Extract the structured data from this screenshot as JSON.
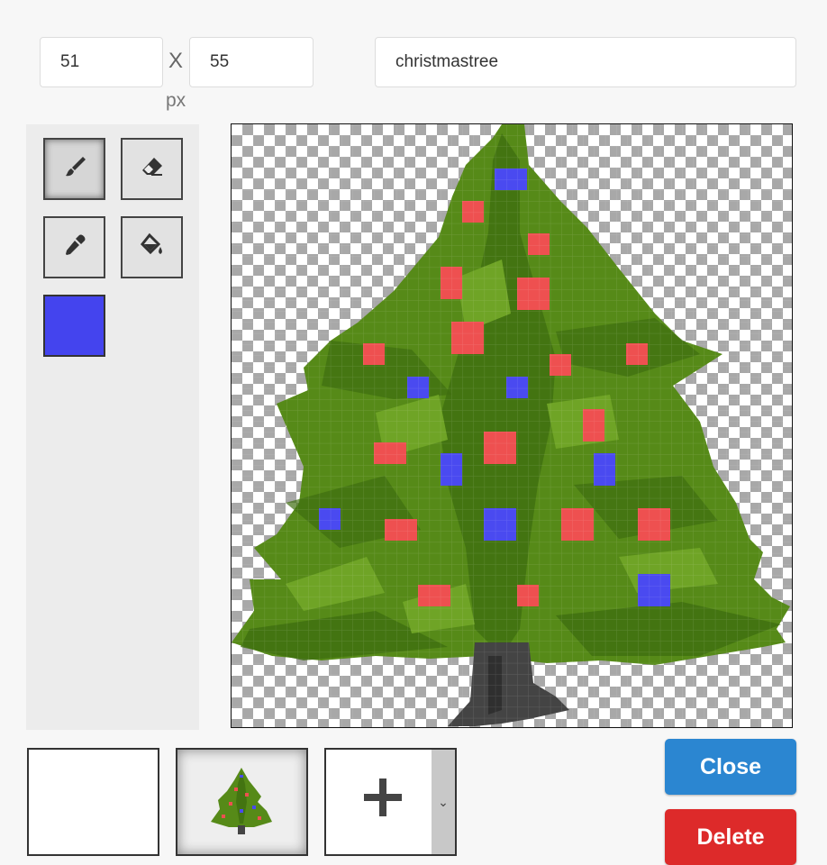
{
  "size": {
    "width_value": "51",
    "height_value": "55",
    "times_label": "X",
    "unit_label": "px"
  },
  "sprite": {
    "name_value": "christmastree"
  },
  "tools": [
    {
      "name": "brush",
      "icon": "paintbrush-icon",
      "active": true
    },
    {
      "name": "eraser",
      "icon": "eraser-icon",
      "active": false
    },
    {
      "name": "eyedropper",
      "icon": "eyedropper-icon",
      "active": false
    },
    {
      "name": "fill",
      "icon": "paint-bucket-icon",
      "active": false
    }
  ],
  "current_color": "#4444ee",
  "canvas": {
    "background": "transparent-checkerboard",
    "colors": {
      "dark_green": "#3f6e10",
      "mid_green": "#568a18",
      "light_green": "#6fa426",
      "ornament_red": "#ee5050",
      "ornament_blue": "#4a4af0",
      "trunk": "#444444"
    }
  },
  "frames": [
    {
      "label": "empty",
      "selected": false
    },
    {
      "label": "christmastree",
      "selected": true
    }
  ],
  "add_frame": {
    "icon": "plus-icon",
    "dropdown_icon": "chevron-down-icon"
  },
  "actions": {
    "close_label": "Close",
    "delete_label": "Delete"
  }
}
